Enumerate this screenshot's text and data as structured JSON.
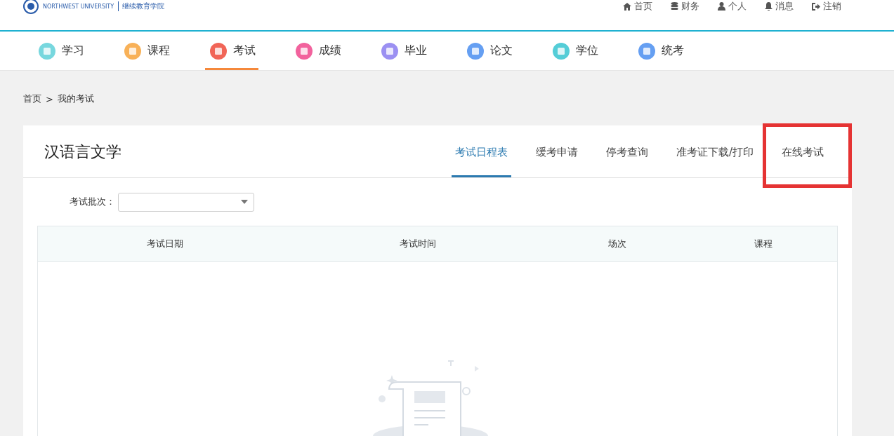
{
  "header": {
    "logo_name": "继续教育学院",
    "logo_subtitle": "NORTHWEST UNIVERSITY",
    "links": [
      {
        "label": "首页"
      },
      {
        "label": "财务"
      },
      {
        "label": "个人"
      },
      {
        "label": "消息"
      },
      {
        "label": "注销"
      }
    ]
  },
  "nav": [
    {
      "label": "学习",
      "selected": false
    },
    {
      "label": "课程",
      "selected": false
    },
    {
      "label": "考试",
      "selected": true
    },
    {
      "label": "成绩",
      "selected": false
    },
    {
      "label": "毕业",
      "selected": false
    },
    {
      "label": "论文",
      "selected": false
    },
    {
      "label": "学位",
      "selected": false
    },
    {
      "label": "统考",
      "selected": false
    }
  ],
  "breadcrumb": {
    "separator": ">",
    "items": [
      "首页",
      "我的考试"
    ]
  },
  "card": {
    "title": "汉语言文学",
    "tabs": [
      {
        "label": "考试日程表",
        "selected": true,
        "highlighted": false
      },
      {
        "label": "缓考申请",
        "selected": false,
        "highlighted": false
      },
      {
        "label": "停考查询",
        "selected": false,
        "highlighted": false
      },
      {
        "label": "准考证下载/打印",
        "selected": false,
        "highlighted": false
      },
      {
        "label": "在线考试",
        "selected": false,
        "highlighted": true
      }
    ],
    "filter": {
      "label": "考试批次："
    },
    "table": {
      "columns": [
        "考试日期",
        "考试时间",
        "场次",
        "课程"
      ]
    }
  }
}
